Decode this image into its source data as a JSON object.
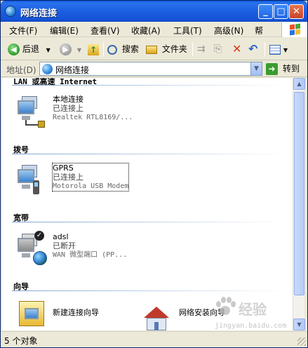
{
  "window": {
    "title": "网络连接"
  },
  "menubar": {
    "items": [
      "文件(F)",
      "编辑(E)",
      "查看(V)",
      "收藏(A)",
      "工具(T)",
      "高级(N)",
      "帮"
    ]
  },
  "toolbar": {
    "back_label": "后退",
    "search_label": "搜索",
    "folders_label": "文件夹"
  },
  "address": {
    "label": "地址(D)",
    "value": "网络连接",
    "go_label": "转到"
  },
  "groups": {
    "lan": {
      "header": "LAN 或高速 Internet"
    },
    "dialup": {
      "header": "拨号"
    },
    "broadband": {
      "header": "宽带"
    },
    "wizard": {
      "header": "向导"
    }
  },
  "connections": {
    "local": {
      "name": "本地连接",
      "status": "已连接上",
      "device": "Realtek RTL8169/..."
    },
    "gprs": {
      "name": "GPRS",
      "status": "已连接上",
      "device": "Motorola USB Modem"
    },
    "adsl": {
      "name": "adsl",
      "status": "已断开",
      "device": "WAN 微型端口 (PP..."
    }
  },
  "wizards": {
    "new_connection": "新建连接向导",
    "network_setup": "网络安装向导"
  },
  "statusbar": {
    "text": "5 个对象"
  },
  "watermark": {
    "brand": "经验",
    "url": "jingyan.baidu.com"
  },
  "colors": {
    "titlebar": "#1c5fe0",
    "window_bg": "#ece9d8",
    "group_line": "#7da2ce"
  }
}
